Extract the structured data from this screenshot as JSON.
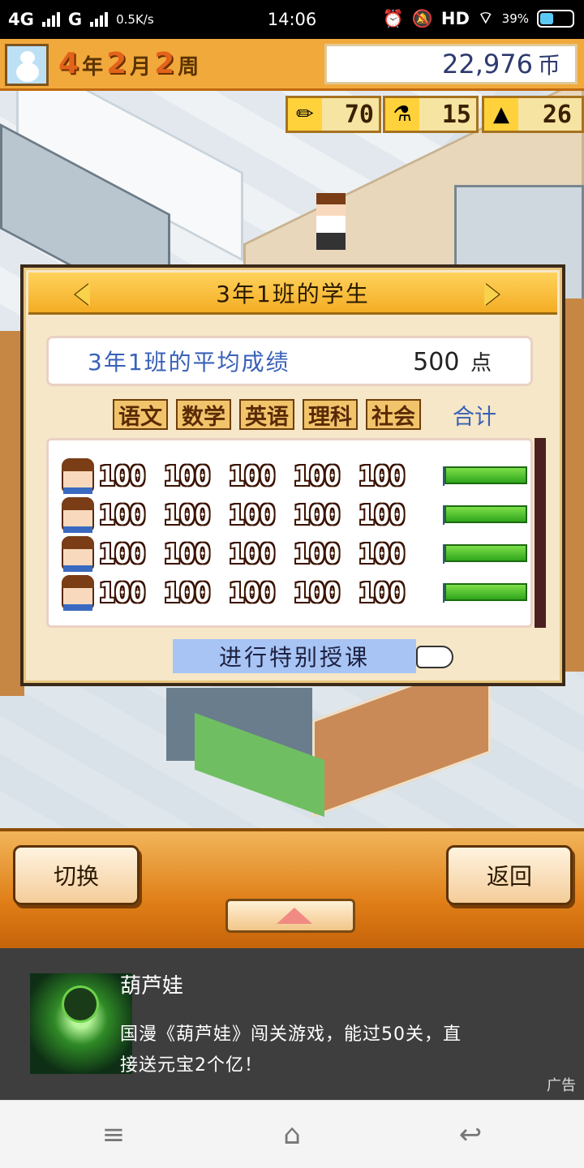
{
  "status_bar": {
    "network1": "4G",
    "network2": "G",
    "speed": "0.5K/s",
    "time": "14:06",
    "hd": "HD",
    "battery": "39%"
  },
  "hud": {
    "year": "4",
    "year_unit": "年",
    "month": "2",
    "month_unit": "月",
    "week": "2",
    "week_unit": "周",
    "money": "22,976",
    "money_unit": "币"
  },
  "resources": [
    {
      "icon": "pencil-icon",
      "value": "70"
    },
    {
      "icon": "flask-icon",
      "value": "15"
    },
    {
      "icon": "pyramid-icon",
      "value": "26"
    }
  ],
  "dialog": {
    "title": "3年1班的学生",
    "average_label": "3年1班的平均成绩",
    "average_value": "500",
    "average_unit": "点",
    "subjects": [
      "语文",
      "数学",
      "英语",
      "理科",
      "社会"
    ],
    "total_label": "合计",
    "students": [
      {
        "scores": [
          "100",
          "100",
          "100",
          "100",
          "100"
        ],
        "total_fraction": 1.0
      },
      {
        "scores": [
          "100",
          "100",
          "100",
          "100",
          "100"
        ],
        "total_fraction": 1.0
      },
      {
        "scores": [
          "100",
          "100",
          "100",
          "100",
          "100"
        ],
        "total_fraction": 1.0
      },
      {
        "scores": [
          "100",
          "100",
          "100",
          "100",
          "100"
        ],
        "total_fraction": 1.0
      }
    ],
    "special_button": "进行特别授课"
  },
  "controls": {
    "switch_label": "切换",
    "back_label": "返回"
  },
  "ad": {
    "title": "葫芦娃",
    "desc": "国漫《葫芦娃》闯关游戏，能过50关，直接送元宝2个亿！",
    "tag": "广告"
  },
  "nav": {
    "menu_icon": "≡",
    "home_icon": "⌂",
    "back_icon": "↩"
  }
}
